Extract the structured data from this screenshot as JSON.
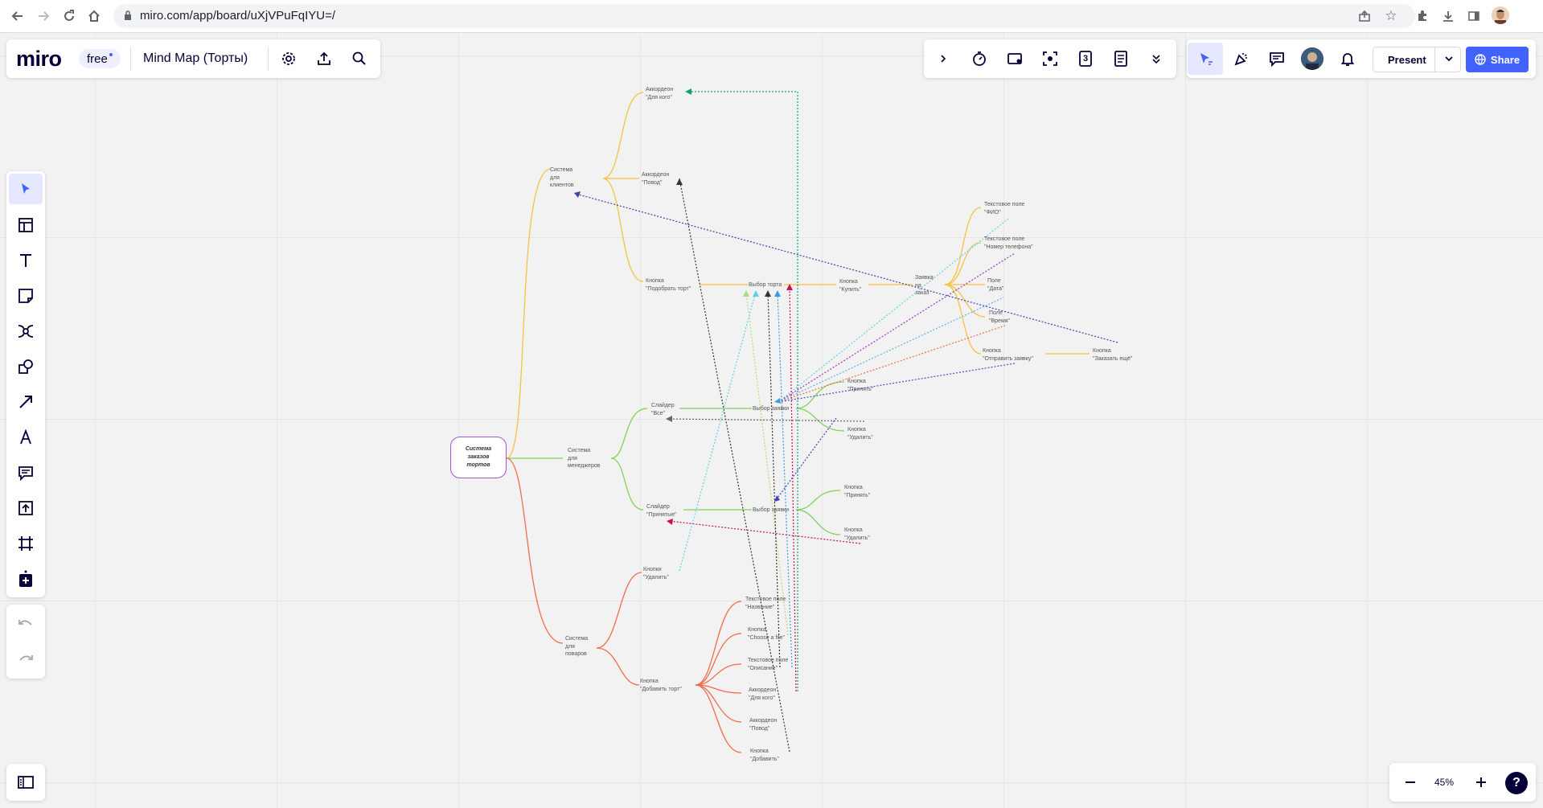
{
  "browser": {
    "url": "miro.com/app/board/uXjVPuFqIYU=/"
  },
  "app": {
    "logo": "miro",
    "plan_badge": "free",
    "board_title": "Mind Map (Торты)",
    "present_label": "Present",
    "share_label": "Share",
    "zoom_level": "45%",
    "help_label": "?",
    "timer_count": "3"
  },
  "toolbar_icons": [
    "select-icon",
    "templates-icon",
    "text-icon",
    "sticky-note-icon",
    "mind-map-icon",
    "shapes-icon",
    "connector-icon",
    "pen-icon",
    "comment-icon",
    "upload-icon",
    "frame-icon",
    "more-apps-icon",
    "undo-icon",
    "redo-icon"
  ],
  "mindmap": {
    "root": "Система\nзаказов\nтортов",
    "branches": {
      "clients": "Система\nдля\nклиентов",
      "managers": "Система\nдля\nменеджеров",
      "cooks": "Система\nдля\nповаров"
    },
    "nodes": {
      "acc_for_whom": "Аккордеон\n\"Для кого\"",
      "acc_occasion": "Аккордеон\n\"Повод\"",
      "btn_pick_cake": "Кнопка\n\"Подобрать торт\"",
      "cake_choice": "Выбор торта",
      "btn_buy": "Кнопка\n\"Купить\"",
      "order": "Заявка\nна\nзаказ",
      "tf_fio": "Текстовое поле\n\"ФИО\"",
      "tf_phone": "Текстовое поле\n\"Номер телефона\"",
      "field_date": "Поле\n\"Дата\"",
      "field_time": "Поле\n\"Время\"",
      "btn_send": "Кнопка\n\"Отправить заявку\"",
      "btn_order_more": "Кнопка\n\"Заказать ещё\"",
      "slider_all": "Слайдер\n\"Все\"",
      "req_choice_1": "Выбор заявки",
      "btn_accept_1": "Кнопка\n\"Принять\"",
      "btn_delete_1": "Кнопка\n\"Удалить\"",
      "slider_accepted": "Слайдер\n\"Принятые\"",
      "req_choice_2": "Выбор заявки",
      "btn_accept_2": "Кнопка\n\"Принять\"",
      "btn_delete_2": "Кнопка\n\"Удалить\"",
      "btns_delete": "Кнопки\n\"Удалить\"",
      "btn_add_cake": "Кнопка\n\"Добавить торт\"",
      "tf_name": "Текстовое поле\n\"Название\"",
      "btn_choose_file": "Кнопка\n\"Choose a file\"",
      "tf_desc": "Текстовое поле\n\"Описание\"",
      "acc_for_whom_2": "Аккордеон\n\"Для кого\"",
      "acc_occasion_2": "Аккордеон\n\"Повод\"",
      "btn_add": "Кнопка\n\"Добавить\""
    }
  },
  "colors": {
    "clients_branch": "#f5c242",
    "managers_branch": "#7fd35a",
    "cooks_branch": "#f26b4c",
    "root_border": "#9b59d0",
    "accent": "#4262ff"
  }
}
